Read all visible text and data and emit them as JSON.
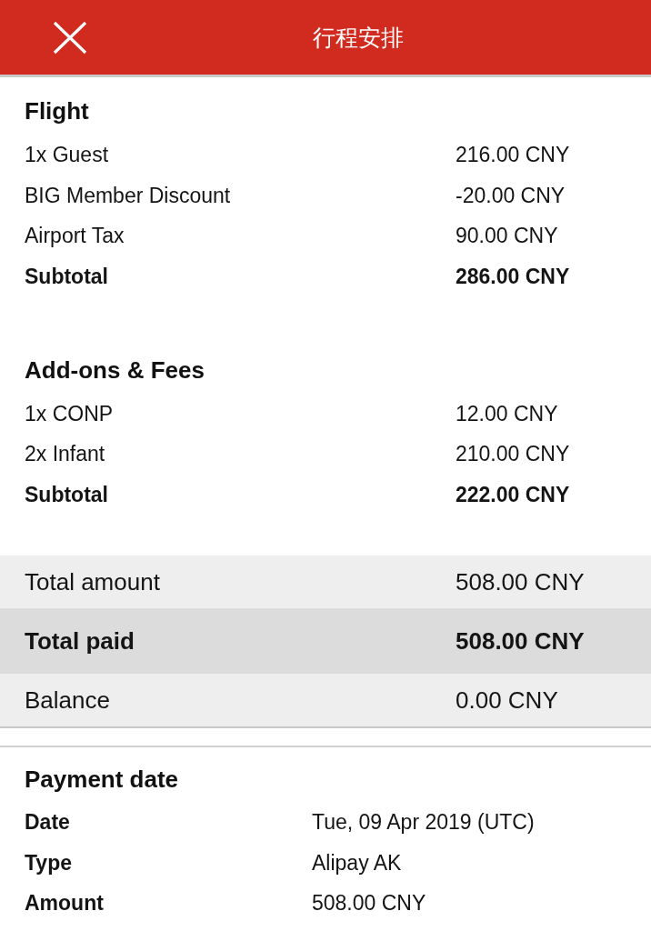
{
  "header": {
    "title": "行程安排"
  },
  "sections": [
    {
      "title": "Flight",
      "rows": [
        {
          "kind": "item",
          "label": "1x Guest",
          "amount": "216.00 CNY"
        },
        {
          "kind": "item",
          "label": "BIG Member Discount",
          "amount": "-20.00 CNY"
        },
        {
          "kind": "item",
          "label": "Airport Tax",
          "amount": "90.00 CNY"
        },
        {
          "kind": "subtotal",
          "label": "Subtotal",
          "amount": "286.00 CNY"
        }
      ]
    },
    {
      "title": "Add-ons & Fees",
      "rows": [
        {
          "kind": "item",
          "label": "1x CONP",
          "amount": "12.00 CNY"
        },
        {
          "kind": "item",
          "label": "2x Infant",
          "amount": "210.00 CNY"
        },
        {
          "kind": "subtotal",
          "label": "Subtotal",
          "amount": "222.00 CNY"
        }
      ]
    }
  ],
  "totals": [
    {
      "kind": "plain",
      "label": "Total amount",
      "amount": "508.00 CNY"
    },
    {
      "kind": "highlight",
      "label": "Total paid",
      "amount": "508.00 CNY"
    },
    {
      "kind": "plain",
      "label": "Balance",
      "amount": "0.00 CNY"
    }
  ],
  "payment": {
    "title": "Payment date",
    "rows": [
      {
        "label": "Date",
        "value": "Tue, 09 Apr 2019 (UTC)"
      },
      {
        "label": "Type",
        "value": "Alipay AK"
      },
      {
        "label": "Amount",
        "value": "508.00 CNY"
      }
    ]
  }
}
